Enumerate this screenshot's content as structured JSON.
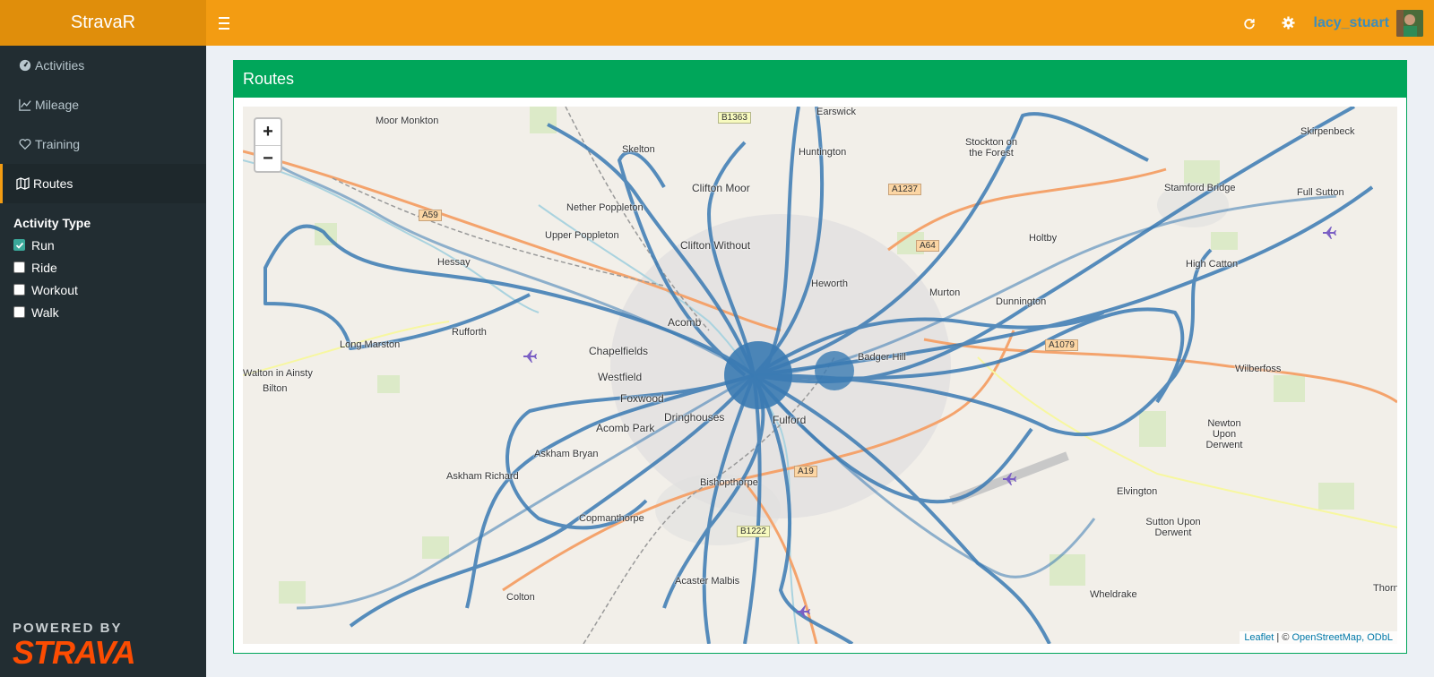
{
  "app": {
    "title": "StravaR"
  },
  "header": {
    "username": "lacy_stuart",
    "icons": [
      "refresh-icon",
      "gear-icon"
    ]
  },
  "sidebar": {
    "items": [
      {
        "label": "Activities",
        "icon": "dashboard-icon"
      },
      {
        "label": "Mileage",
        "icon": "line-chart-icon"
      },
      {
        "label": "Training",
        "icon": "heart-icon"
      },
      {
        "label": "Routes",
        "icon": "map-icon",
        "active": true
      }
    ],
    "filter": {
      "title": "Activity Type",
      "options": [
        {
          "label": "Run",
          "checked": true
        },
        {
          "label": "Ride",
          "checked": false
        },
        {
          "label": "Workout",
          "checked": false
        },
        {
          "label": "Walk",
          "checked": false
        }
      ]
    },
    "powered_by": "POWERED BY",
    "brand": "STRAVA"
  },
  "main": {
    "box_title": "Routes",
    "zoom_in": "+",
    "zoom_out": "−",
    "attribution": {
      "leaflet": "Leaflet",
      "sep": " | © ",
      "osm": "OpenStreetMap, ODbL"
    },
    "places": [
      "Earswick",
      "Moor Monkton",
      "Skelton",
      "Huntington",
      "Stockton on the Forest",
      "Skirpenbeck",
      "Clifton Moor",
      "Stamford Bridge",
      "Full Sutton",
      "Nether Poppleton",
      "Upper Poppleton",
      "Clifton Without",
      "Heworth",
      "Holtby",
      "High Catton",
      "Hessay",
      "Dunnington",
      "Murton",
      "Rufforth",
      "Long Marston",
      "Chapelfields",
      "Westfield",
      "Foxwood",
      "Badger Hill",
      "Wilberfoss",
      "Bilton",
      "Acomb Park",
      "Dringhouses",
      "Fulford",
      "Newton Upon Derwent",
      "Askham Bryan",
      "Askham Richard",
      "Elvington",
      "Copmanthorpe",
      "Sutton Upon Derwent",
      "Bishopthorpe",
      "Acaster Malbis",
      "Colton",
      "Wheldrake",
      "Thorn",
      "Walton in Ainsty",
      "Acomb"
    ],
    "roads": [
      "B1363",
      "A1237",
      "A59",
      "A64",
      "A1079",
      "A19",
      "B1222"
    ],
    "colors": {
      "header": "#f39c12",
      "logo": "#e08e0b",
      "sidebar": "#222d32",
      "box": "#00a65a",
      "route": "#3a7ab3",
      "strava": "#fc4c02"
    }
  }
}
